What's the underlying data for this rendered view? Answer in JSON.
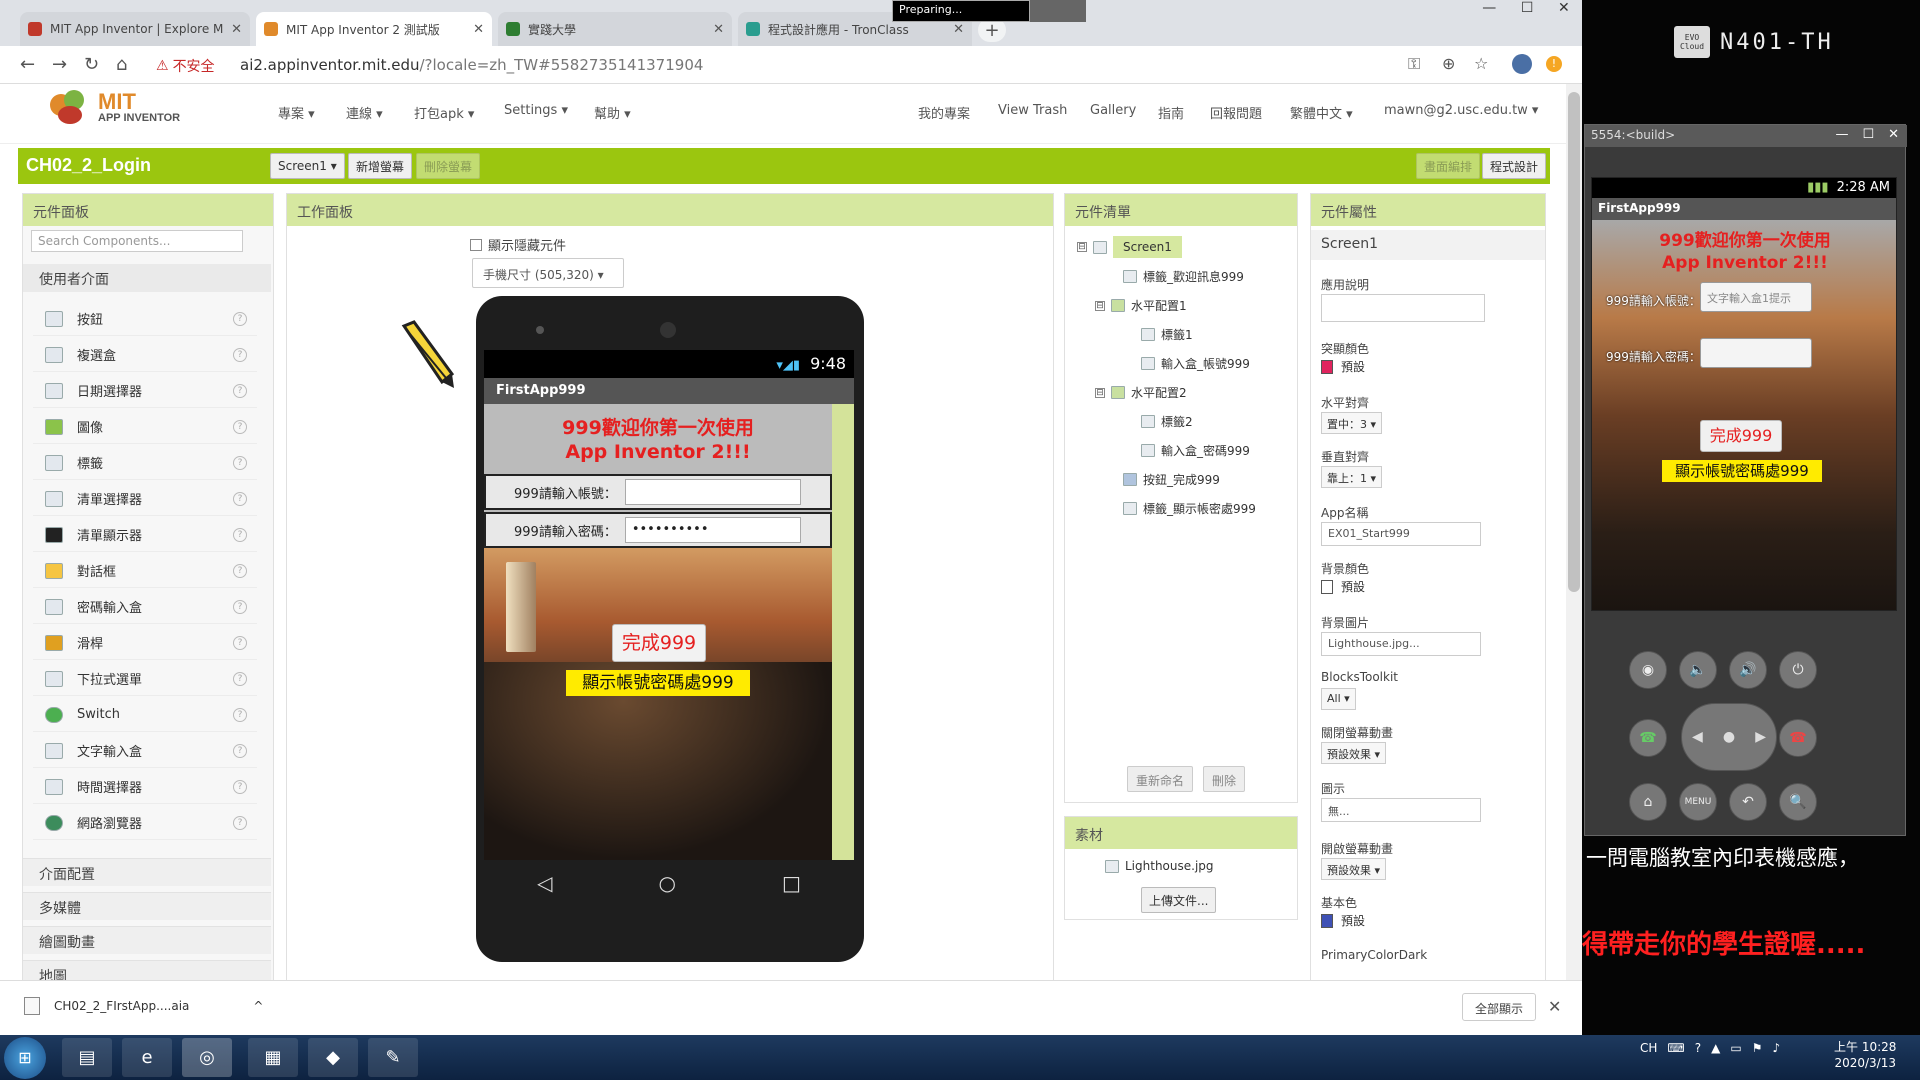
{
  "desktop": {
    "network_label": "N401-TH",
    "network_icon_text": "EVO Cloud",
    "subtitle_line1": "一問電腦教室內印表機感應，",
    "subtitle_line2": "得帶走你的學生證喔....."
  },
  "browser": {
    "tabs": [
      {
        "title": "MIT App Inventor | Explore MIT",
        "close": "✕",
        "color": "#c0392b"
      },
      {
        "title": "MIT App Inventor 2 測試版",
        "close": "✕",
        "color": "#e08a2b"
      },
      {
        "title": "實踐大學",
        "close": "✕",
        "color": "#2e7d32"
      },
      {
        "title": "程式設計應用 - TronClass",
        "close": "✕",
        "color": "#2a9d8f"
      }
    ],
    "new_tab": "+",
    "preparing": "Preparing...",
    "window_controls": [
      "—",
      "☐",
      "✕"
    ],
    "insecure_label": "不安全",
    "url_host": "ai2.appinventor.mit.edu",
    "url_path": "/?locale=zh_TW#5582735141371904"
  },
  "app": {
    "logo_mit": "MIT",
    "logo_sub": "APP INVENTOR",
    "menu_left": [
      "專案 ▾",
      "連線 ▾",
      "打包apk ▾",
      "Settings ▾",
      "幫助 ▾"
    ],
    "menu_right": [
      "我的專案",
      "View Trash",
      "Gallery",
      "指南",
      "回報問題",
      "繁體中文 ▾",
      "mawn@g2.usc.edu.tw ▾"
    ],
    "project_name": "CH02_2_Login",
    "screen_select": "Screen1 ▾",
    "add_screen": "新增螢幕",
    "remove_screen": "刪除螢幕",
    "designer": "畫面編排",
    "blocks": "程式設計"
  },
  "palette": {
    "title": "元件面板",
    "search_placeholder": "Search Components...",
    "category": "使用者介面",
    "items": [
      "按鈕",
      "複選盒",
      "日期選擇器",
      "圖像",
      "標籤",
      "清單選擇器",
      "清單顯示器",
      "對話框",
      "密碼輸入盒",
      "滑桿",
      "下拉式選單",
      "Switch",
      "文字輸入盒",
      "時間選擇器",
      "網路瀏覽器"
    ],
    "help": "?",
    "subcategories": [
      "介面配置",
      "多媒體",
      "繪圖動畫",
      "地圖"
    ]
  },
  "viewer": {
    "title": "工作面板",
    "show_hidden": "顯示隱藏元件",
    "size_select": "手機尺寸 (505,320) ▾",
    "status_time": "9:48",
    "signal_glyphs": "▾◢▮",
    "app_title": "FirstApp999",
    "welcome_line1": "999歡迎你第一次使用",
    "welcome_line2": "App Inventor 2!!!",
    "username_label": "999請輸入帳號：",
    "password_label": "999請輸入密碼：",
    "password_value": "••••••••••",
    "done_button": "完成999",
    "display_label": "顯示帳號密碼處999",
    "nav_back": "◁",
    "nav_home": "○",
    "nav_recent": "□"
  },
  "tree": {
    "title": "元件清單",
    "nodes": [
      {
        "label": "Screen1",
        "toggle": "⊟"
      },
      {
        "label": "標籤_歡迎訊息999",
        "toggle": ""
      },
      {
        "label": "水平配置1",
        "toggle": "⊟"
      },
      {
        "label": "標籤1",
        "toggle": ""
      },
      {
        "label": "輸入盒_帳號999",
        "toggle": ""
      },
      {
        "label": "水平配置2",
        "toggle": "⊟"
      },
      {
        "label": "標籤2",
        "toggle": ""
      },
      {
        "label": "輸入盒_密碼999",
        "toggle": ""
      },
      {
        "label": "按鈕_完成999",
        "toggle": ""
      },
      {
        "label": "標籤_顯示帳密處999",
        "toggle": ""
      }
    ],
    "rename": "重新命名",
    "delete": "刪除"
  },
  "media": {
    "title": "素材",
    "file": "Lighthouse.jpg",
    "upload": "上傳文件..."
  },
  "properties": {
    "title": "元件屬性",
    "component": "Screen1",
    "about_label": "應用說明",
    "accent_label": "突顯顏色",
    "accent_value": "預設",
    "accent_color": "#e0245e",
    "halign_label": "水平對齊",
    "halign_value": "置中：3 ▾",
    "valign_label": "垂直對齊",
    "valign_value": "靠上：1 ▾",
    "appname_label": "App名稱",
    "appname_value": "EX01_Start999",
    "bgcolor_label": "背景顏色",
    "bgcolor_value": "預設",
    "bgcolor_color": "#ffffff",
    "bgimage_label": "背景圖片",
    "bgimage_value": "Lighthouse.jpg...",
    "toolkit_label": "BlocksToolkit",
    "toolkit_value": "All ▾",
    "close_anim_label": "關閉螢幕動畫",
    "close_anim_value": "預設效果 ▾",
    "icon_label": "圖示",
    "icon_value": "無...",
    "open_anim_label": "開啟螢幕動畫",
    "open_anim_value": "預設效果 ▾",
    "primary_label": "基本色",
    "primary_value": "預設",
    "primary_color": "#3f51b5",
    "primary_dark_label": "PrimaryColorDark"
  },
  "download": {
    "file": "CH02_2_FIrstApp....aia",
    "chevron": "^",
    "show_all": "全部顯示",
    "close": "✕"
  },
  "emulator": {
    "title": "5554:<build>",
    "controls": [
      "—",
      "☐",
      "✕"
    ],
    "time": "2:28 AM",
    "app_title": "FirstApp999",
    "welcome_line1": "999歡迎你第一次使用",
    "welcome_line2": "App Inventor 2!!!",
    "username_label": "999請輸入帳號：",
    "username_placeholder": "文字輸入盒1提示",
    "password_label": "999請輸入密碼：",
    "done_button": "完成999",
    "display_label": "顯示帳號密碼處999",
    "keys_row1": [
      "◉",
      "🔈",
      "🔊",
      "⏻"
    ],
    "keys_row3": [
      "⌂",
      "MENU",
      "↶",
      "🔍"
    ],
    "call_icon": "☎",
    "end_icon": "☎"
  },
  "taskbar": {
    "start": "⊞",
    "ime": "CH",
    "clock_time": "上午 10:28",
    "clock_date": "2020/3/13"
  }
}
